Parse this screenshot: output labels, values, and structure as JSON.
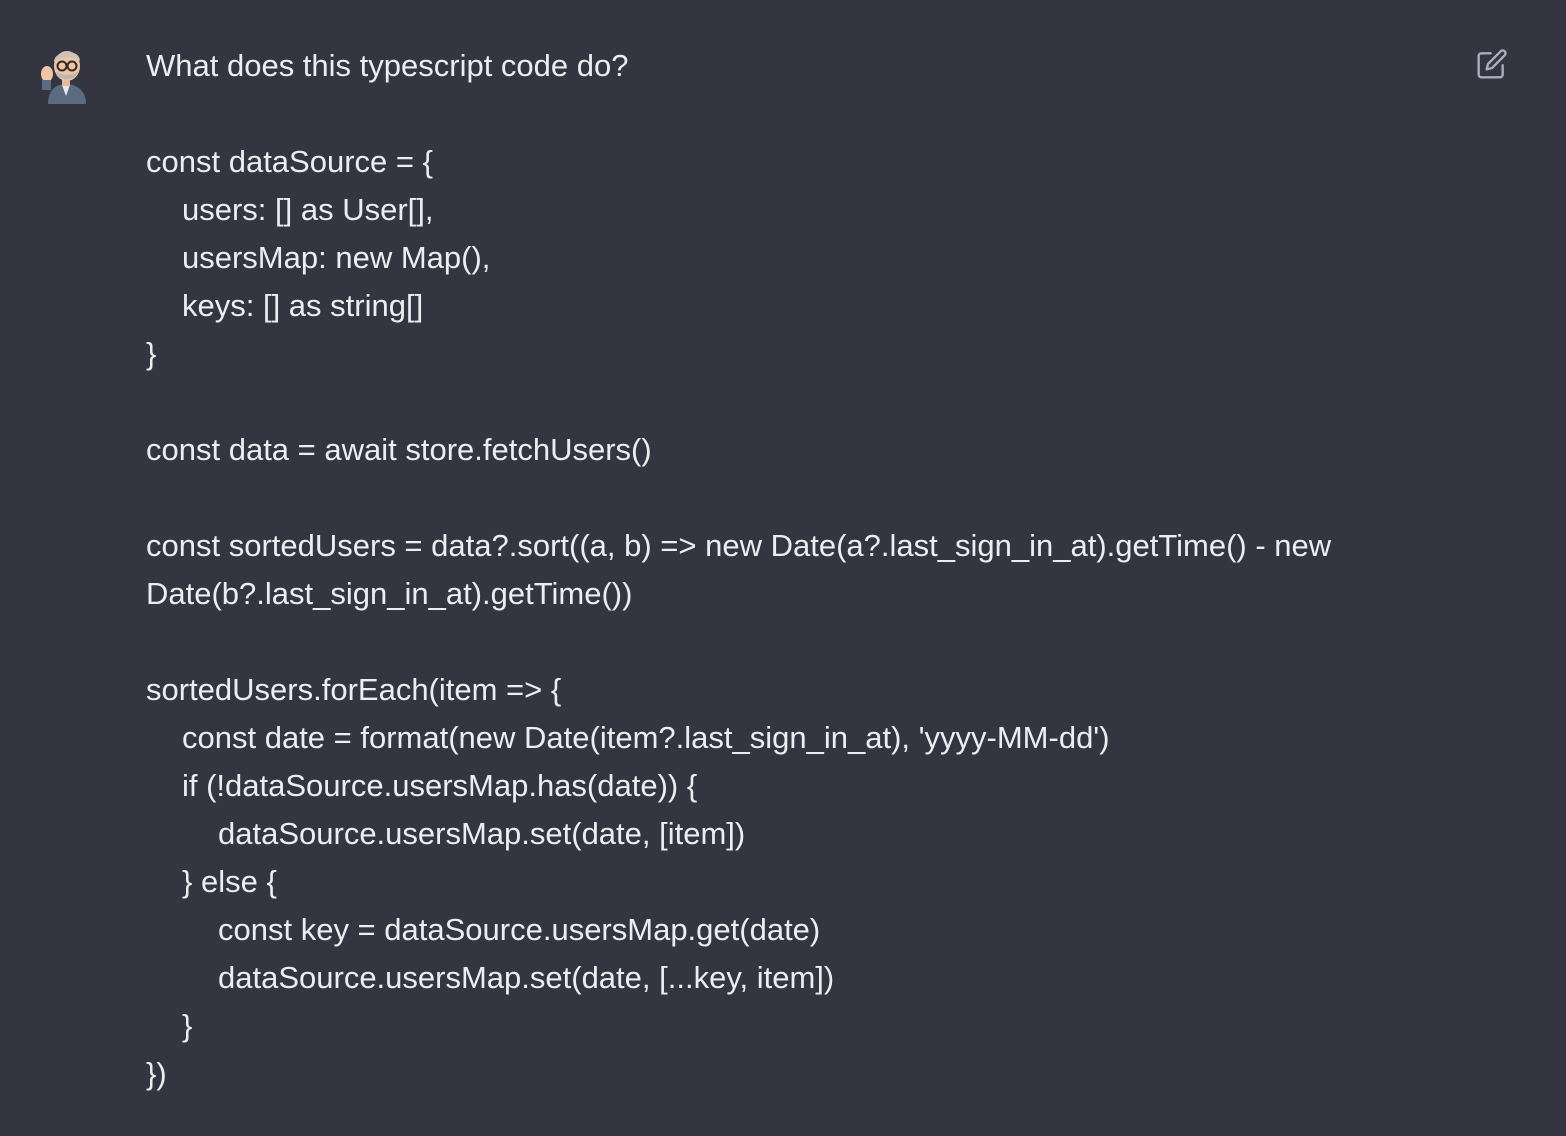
{
  "message": {
    "role": "user",
    "question": "What does this typescript code do?",
    "code_lines": [
      "const dataSource = {",
      "users: [] as User[],",
      "usersMap: new Map(),",
      "keys: [] as string[]",
      "}",
      "const data = await store.fetchUsers()",
      "const sortedUsers = data?.sort((a, b) => new Date(a?.last_sign_in_at).getTime() - new Date(b?.last_sign_in_at).getTime())",
      "sortedUsers.forEach(item => {",
      "const date = format(new Date(item?.last_sign_in_at), 'yyyy-MM-dd')",
      "if (!dataSource.usersMap.has(date)) {",
      "dataSource.usersMap.set(date, [item])",
      "} else {",
      "const key = dataSource.usersMap.get(date)",
      "dataSource.usersMap.set(date, [...key, item])",
      "}",
      "})"
    ]
  },
  "icons": {
    "avatar": "memoji-avatar-icon",
    "edit": "edit-icon"
  },
  "colors": {
    "background": "#343541",
    "text": "#ececf1",
    "icon": "#acacbe"
  }
}
